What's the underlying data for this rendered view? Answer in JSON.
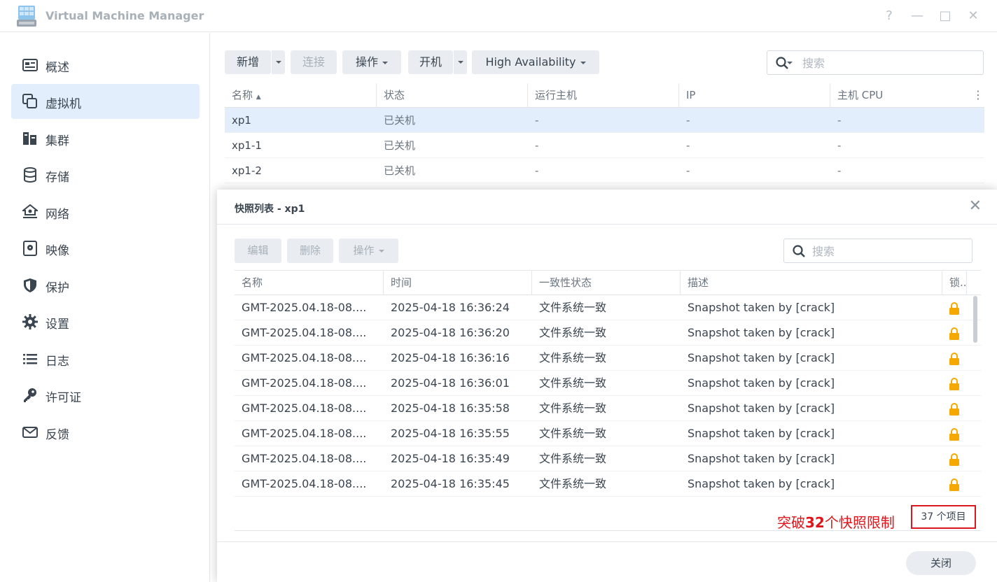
{
  "app": {
    "title": "Virtual Machine Manager",
    "icon": "vmm-app-icon",
    "window_controls": {
      "help": "?",
      "minimize": "—",
      "maximize": "□",
      "close": "✕"
    }
  },
  "sidebar": {
    "items": [
      {
        "label": "概述",
        "icon": "overview-icon",
        "active": false
      },
      {
        "label": "虚拟机",
        "icon": "virtual-machine-icon",
        "active": true
      },
      {
        "label": "集群",
        "icon": "cluster-icon",
        "active": false
      },
      {
        "label": "存储",
        "icon": "storage-icon",
        "active": false
      },
      {
        "label": "网络",
        "icon": "network-icon",
        "active": false
      },
      {
        "label": "映像",
        "icon": "image-icon",
        "active": false
      },
      {
        "label": "保护",
        "icon": "shield-icon",
        "active": false
      },
      {
        "label": "设置",
        "icon": "gear-icon",
        "active": false
      },
      {
        "label": "日志",
        "icon": "list-icon",
        "active": false
      },
      {
        "label": "许可证",
        "icon": "key-icon",
        "active": false
      },
      {
        "label": "反馈",
        "icon": "mail-icon",
        "active": false
      }
    ]
  },
  "toolbar": {
    "add_label": "新增",
    "connect_label": "连接",
    "action_label": "操作",
    "power_on_label": "开机",
    "ha_label": "High Availability",
    "search_placeholder": "搜索"
  },
  "vm_table": {
    "columns": [
      "名称",
      "状态",
      "运行主机",
      "IP",
      "主机 CPU"
    ],
    "sort_indicator": "▲",
    "rows": [
      {
        "name": "xp1",
        "status": "已关机",
        "host": "-",
        "ip": "-",
        "cpu": "-",
        "selected": true
      },
      {
        "name": "xp1-1",
        "status": "已关机",
        "host": "-",
        "ip": "-",
        "cpu": "-",
        "selected": false
      },
      {
        "name": "xp1-2",
        "status": "已关机",
        "host": "-",
        "ip": "-",
        "cpu": "-",
        "selected": false
      }
    ]
  },
  "snapshot_dialog": {
    "title": "快照列表 - xp1",
    "close_icon": "✕",
    "edit_label": "编辑",
    "delete_label": "删除",
    "action_label": "操作",
    "search_placeholder": "搜索",
    "columns": [
      "名称",
      "时间",
      "一致性状态",
      "描述",
      "锁.."
    ],
    "rows": [
      {
        "name": "GMT-2025.04.18-08....",
        "time": "2025-04-18 16:36:24",
        "consistency": "文件系统一致",
        "desc": "Snapshot taken by [crack]",
        "locked": true
      },
      {
        "name": "GMT-2025.04.18-08....",
        "time": "2025-04-18 16:36:20",
        "consistency": "文件系统一致",
        "desc": "Snapshot taken by [crack]",
        "locked": true
      },
      {
        "name": "GMT-2025.04.18-08....",
        "time": "2025-04-18 16:36:16",
        "consistency": "文件系统一致",
        "desc": "Snapshot taken by [crack]",
        "locked": true
      },
      {
        "name": "GMT-2025.04.18-08....",
        "time": "2025-04-18 16:36:01",
        "consistency": "文件系统一致",
        "desc": "Snapshot taken by [crack]",
        "locked": true
      },
      {
        "name": "GMT-2025.04.18-08....",
        "time": "2025-04-18 16:35:58",
        "consistency": "文件系统一致",
        "desc": "Snapshot taken by [crack]",
        "locked": true
      },
      {
        "name": "GMT-2025.04.18-08....",
        "time": "2025-04-18 16:35:55",
        "consistency": "文件系统一致",
        "desc": "Snapshot taken by [crack]",
        "locked": true
      },
      {
        "name": "GMT-2025.04.18-08....",
        "time": "2025-04-18 16:35:49",
        "consistency": "文件系统一致",
        "desc": "Snapshot taken by [crack]",
        "locked": true
      },
      {
        "name": "GMT-2025.04.18-08....",
        "time": "2025-04-18 16:35:45",
        "consistency": "文件系统一致",
        "desc": "Snapshot taken by [crack]",
        "locked": true
      }
    ],
    "annotation_prefix": "突破",
    "annotation_number": "32",
    "annotation_suffix": "个快照限制",
    "item_count": "37 个项目",
    "close_button": "关闭"
  },
  "colors": {
    "accent_selected": "#e2eefb",
    "lock": "#f5a800",
    "annotation_red": "#e0151b"
  }
}
